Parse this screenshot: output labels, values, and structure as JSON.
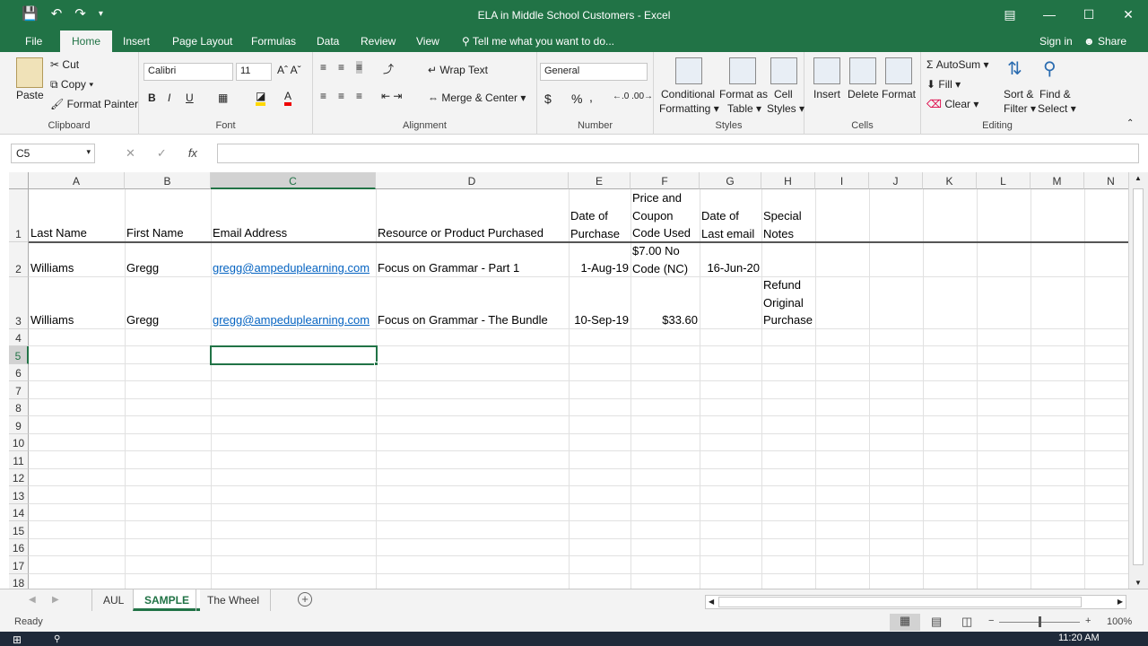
{
  "window": {
    "title": "ELA in Middle School Customers - Excel"
  },
  "menu": {
    "tabs": [
      "File",
      "Home",
      "Insert",
      "Page Layout",
      "Formulas",
      "Data",
      "Review",
      "View"
    ],
    "active": "Home",
    "tell_me": "Tell me what you want to do...",
    "sign_in": "Sign in",
    "share": "Share"
  },
  "ribbon": {
    "clipboard": {
      "paste": "Paste",
      "cut": "Cut",
      "copy": "Copy",
      "format_painter": "Format Painter",
      "label": "Clipboard"
    },
    "font": {
      "name": "Calibri",
      "size": "11",
      "label": "Font"
    },
    "alignment": {
      "wrap_text": "Wrap Text",
      "merge_center": "Merge & Center",
      "label": "Alignment"
    },
    "number": {
      "format": "General",
      "currency": "$",
      "percent": "%",
      "comma": ",",
      "label": "Number"
    },
    "styles": {
      "conditional": "Conditional",
      "formatting": "Formatting",
      "format_as": "Format as",
      "table": "Table",
      "cell": "Cell",
      "styles": "Styles",
      "label": "Styles"
    },
    "cells": {
      "insert": "Insert",
      "delete": "Delete",
      "format": "Format",
      "label": "Cells"
    },
    "editing": {
      "autosum": "AutoSum",
      "fill": "Fill",
      "clear": "Clear",
      "sort": "Sort &",
      "filter": "Filter",
      "find": "Find &",
      "select": "Select",
      "label": "Editing"
    }
  },
  "formula_bar": {
    "name_box": "C5",
    "fx": "fx",
    "value": ""
  },
  "columns": [
    "A",
    "B",
    "C",
    "D",
    "E",
    "F",
    "G",
    "H",
    "I",
    "J",
    "K",
    "L",
    "M",
    "N"
  ],
  "rows": [
    "1",
    "2",
    "3",
    "4",
    "5",
    "6",
    "7",
    "8",
    "9",
    "10",
    "11",
    "12",
    "13",
    "14",
    "15",
    "16",
    "17",
    "18"
  ],
  "cells": {
    "A1": "Last Name",
    "B1": "First Name",
    "C1": "Email Address",
    "D1": "Resource or Product Purchased",
    "E1a": "Date of",
    "E1b": "Purchase",
    "F1a": "Price and",
    "F1b": "Coupon",
    "F1c": "Code Used",
    "G1a": "Date of",
    "G1b": "Last email",
    "H1a": "Special",
    "H1b": "Notes",
    "A2": "Williams",
    "B2": "Gregg",
    "C2": "gregg@ampeduplearning.com",
    "D2": "Focus on Grammar - Part 1",
    "E2": "1-Aug-19",
    "F2a": "$7.00 No",
    "F2b": "Code (NC)",
    "G2": "16-Jun-20",
    "A3": "Williams",
    "B3": "Gregg",
    "C3": "gregg@ampeduplearning.com",
    "D3": "Focus on Grammar - The Bundle",
    "E3": "10-Sep-19",
    "F3": "$33.60",
    "H3a": "Refund",
    "H3b": "Original",
    "H3c": "Purchase"
  },
  "sheets": [
    "AUL",
    "SAMPLE",
    "The Wheel"
  ],
  "active_sheet": "SAMPLE",
  "status": {
    "ready": "Ready",
    "zoom": "100%"
  },
  "taskbar": {
    "time": "11:20 AM"
  }
}
